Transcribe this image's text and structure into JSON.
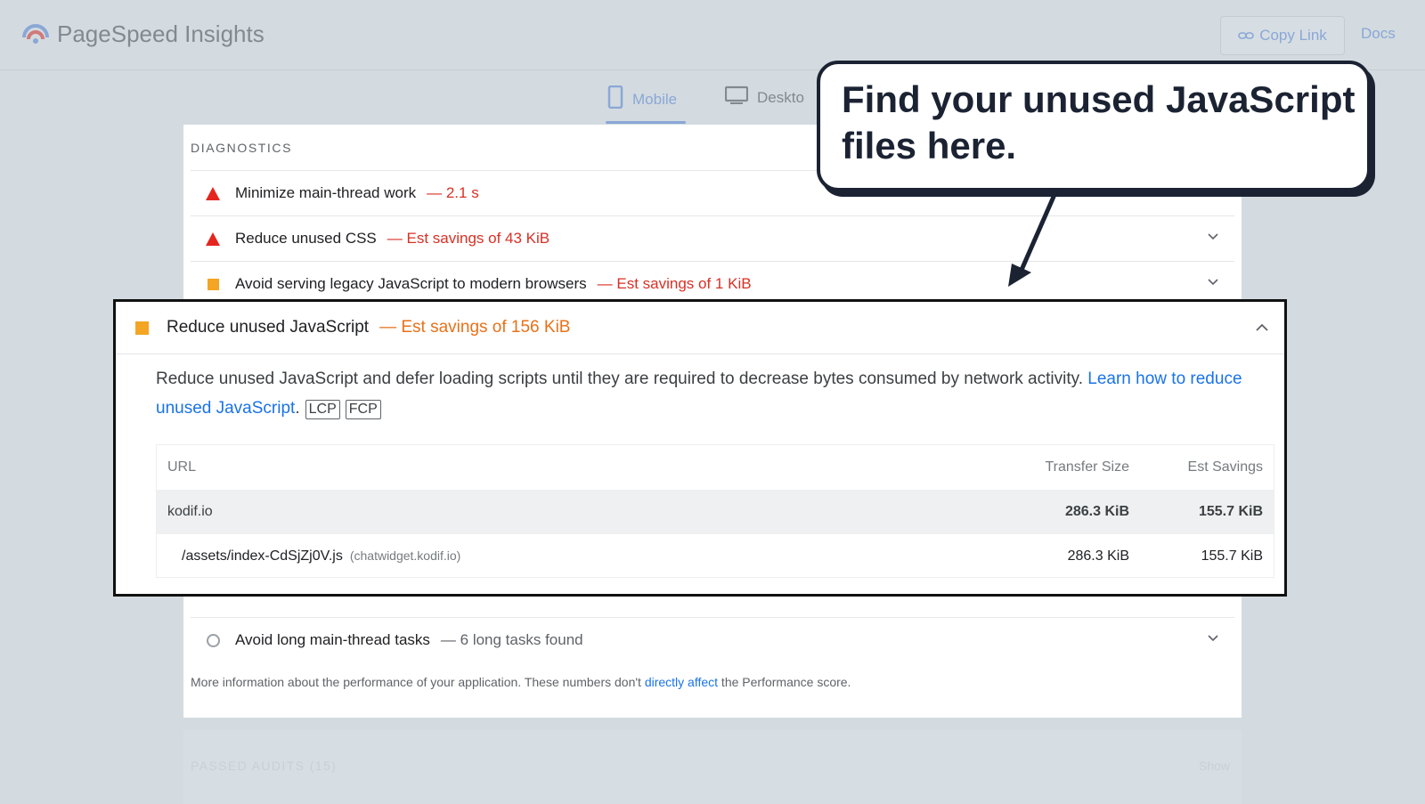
{
  "header": {
    "app_name": "PageSpeed Insights",
    "copy_link_label": "Copy Link",
    "docs_label": "Docs"
  },
  "tabs": [
    {
      "label": "Mobile",
      "selected": true
    },
    {
      "label": "Deskto",
      "selected": false
    }
  ],
  "diagnostics": {
    "section_title": "DIAGNOSTICS",
    "rows": [
      {
        "icon": "red-triangle-icon",
        "title": "Minimize main-thread work",
        "detail": "— 2.1 s"
      },
      {
        "icon": "red-triangle-icon",
        "title": "Reduce unused CSS",
        "detail": "— Est savings of 43 KiB"
      },
      {
        "icon": "orange-square-icon",
        "title": "Avoid serving legacy JavaScript to modern browsers",
        "detail": "— Est savings of 1 KiB"
      },
      {
        "icon": "grey-circle-icon",
        "title": "Avoid long main-thread tasks",
        "detail": "— 6 long tasks found"
      }
    ],
    "footer_prefix": "More information about the performance of your application. These numbers don't ",
    "footer_link": "directly affect",
    "footer_suffix": " the Performance score."
  },
  "passed_audits": {
    "label": "PASSED AUDITS (15)",
    "show_label": "Show"
  },
  "highlight": {
    "title": "Reduce unused JavaScript",
    "detail": "— Est savings of 156 KiB",
    "description": "Reduce unused JavaScript and defer loading scripts until they are required to decrease bytes consumed by network activity. ",
    "learn_link": "Learn how to reduce unused JavaScript",
    "badges": [
      "LCP",
      "FCP"
    ],
    "table": {
      "headers": [
        "URL",
        "Transfer Size",
        "Est Savings"
      ],
      "group": {
        "url": "kodif.io",
        "transfer_size": "286.3 KiB",
        "est_savings": "155.7 KiB"
      },
      "child": {
        "url": "/assets/index-CdSjZj0V.js",
        "origin": "(chatwidget.kodif.io)",
        "transfer_size": "286.3 KiB",
        "est_savings": "155.7 KiB"
      }
    }
  },
  "callout": {
    "text": "Find your unused JavaScript files here."
  },
  "colors": {
    "accent": "#1a73e8",
    "fail": "#e5251f",
    "average": "#f4a524",
    "callout_border": "#1b2333"
  }
}
